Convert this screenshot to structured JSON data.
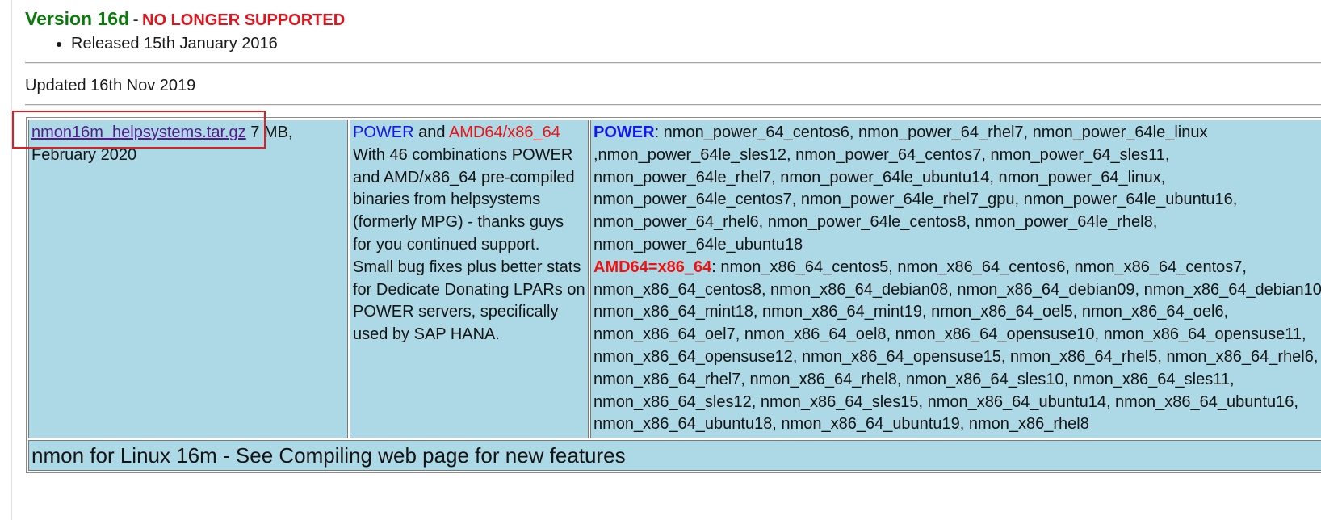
{
  "version": {
    "title": "Version 16d",
    "separator": "-",
    "status": "NO LONGER SUPPORTED",
    "released": "Released 15th January 2016"
  },
  "updated": "Updated 16th Nov 2019",
  "row": {
    "download_link": "nmon16m_helpsystems.tar.gz",
    "size_date": " 7 MB, February 2020",
    "platform_power": "POWER",
    "platform_and": " and ",
    "platform_amd": "AMD64/x86_64",
    "description": "With 46 combinations POWER and AMD/x86_64 pre-compiled binaries from helpsystems (formerly MPG) - thanks guys for you continued support.",
    "notes": "Small bug fixes plus better stats for Dedicate Donating LPARs on POWER servers, specifically used by SAP HANA.",
    "power_label": "POWER",
    "power_binaries": ": nmon_power_64_centos6, nmon_power_64_rhel7, nmon_power_64le_linux ,nmon_power_64le_sles12, nmon_power_64_centos7, nmon_power_64_sles11, nmon_power_64le_rhel7, nmon_power_64le_ubuntu14, nmon_power_64_linux, nmon_power_64le_centos7, nmon_power_64le_rhel7_gpu, nmon_power_64le_ubuntu16, nmon_power_64_rhel6, nmon_power_64le_centos8, nmon_power_64le_rhel8, nmon_power_64le_ubuntu18",
    "amd_label": "AMD64=x86_64",
    "amd_binaries": ": nmon_x86_64_centos5, nmon_x86_64_centos6, nmon_x86_64_centos7, nmon_x86_64_centos8, nmon_x86_64_debian08, nmon_x86_64_debian09, nmon_x86_64_debian10, nmon_x86_64_mint18, nmon_x86_64_mint19, nmon_x86_64_oel5, nmon_x86_64_oel6, nmon_x86_64_oel7, nmon_x86_64_oel8, nmon_x86_64_opensuse10, nmon_x86_64_opensuse11, nmon_x86_64_opensuse12, nmon_x86_64_opensuse15, nmon_x86_64_rhel5, nmon_x86_64_rhel6, nmon_x86_64_rhel7, nmon_x86_64_rhel8, nmon_x86_64_sles10, nmon_x86_64_sles11, nmon_x86_64_sles12, nmon_x86_64_sles15, nmon_x86_64_ubuntu14, nmon_x86_64_ubuntu16, nmon_x86_64_ubuntu18, nmon_x86_64_ubuntu19, nmon_x86_rhel8"
  },
  "next_row_heading": "nmon for Linux 16m - See Compiling web page for new features"
}
